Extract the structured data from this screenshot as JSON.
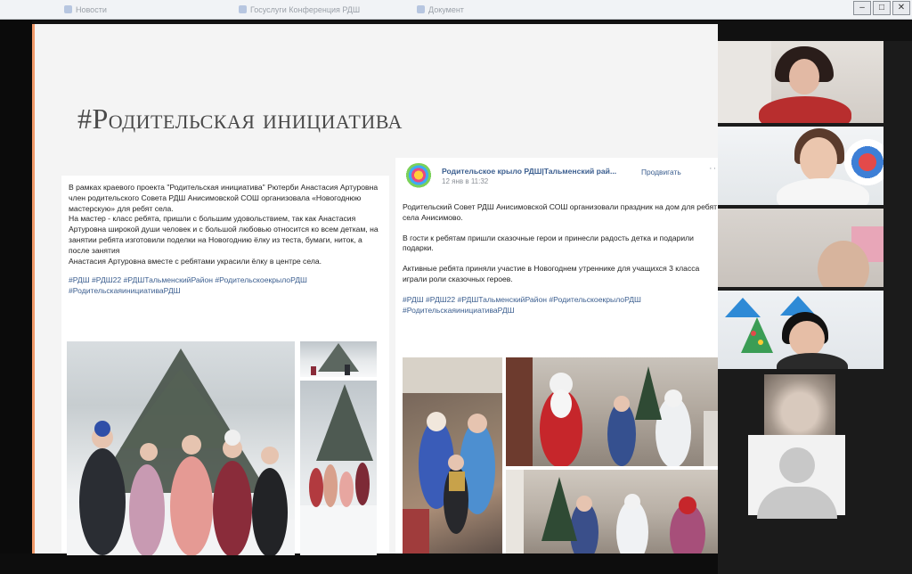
{
  "browser": {
    "tabs": [
      "Новости",
      "Госуслуги Конференция РДШ",
      "Документ"
    ],
    "window_controls": [
      "–",
      "□",
      "✕"
    ]
  },
  "slide": {
    "title": "#Родительская инициатива",
    "left_post": {
      "text": "В рамках краевого проекта \"Родительская инициатива\" Рютерби Анастасия Артуровна член родительского Совета РДШ Анисимовской СОШ организовала «Новогоднюю мастерскую» для ребят села.\nНа мастер - класс ребята, пришли с большим удовольствием, так как Анастасия Артуровна широкой души человек и с большой любовью относится ко всем деткам, на занятии ребята изготовили поделки на Новогоднию ёлку из теста, бумаги, ниток, а после занятия\nАнастасия Артуровна вместе с ребятами украсили ёлку в центре села.",
      "tags": "#РДШ #РДШ22 #РДШТальменскийРайон #РодительскоекрылоРДШ #РодительскаяинициативаРДШ"
    },
    "right_post": {
      "author": "Родительское крыло РДШ|Тальменский рай...",
      "date": "12 янв в 11:32",
      "share_label": "Продвигать",
      "more_label": "···",
      "paragraphs": [
        "Родительский Совет РДШ Анисимовской СОШ организовали праздник на дом для ребят села Анисимово.",
        "В гости к ребятам пришли сказочные герои и принесли радость детка и подарили подарки.",
        "Активные ребята приняли участие в Новогоднем утреннике для учащихся 3 класса играли роли сказочных героев."
      ],
      "tags": "#РДШ #РДШ22 #РДШТальменскийРайон #РодительскоекрылоРДШ #РодительскаяинициативаРДШ"
    }
  },
  "colors": {
    "accent_orange": "#f19a6a",
    "link_blue": "#3b5e8f",
    "slide_bg": "#f4f4f4",
    "stage_bg": "#111111"
  },
  "icons": {
    "participant_avatar": "user-silhouette-icon",
    "group_logo": "rdsh-logo-icon"
  }
}
